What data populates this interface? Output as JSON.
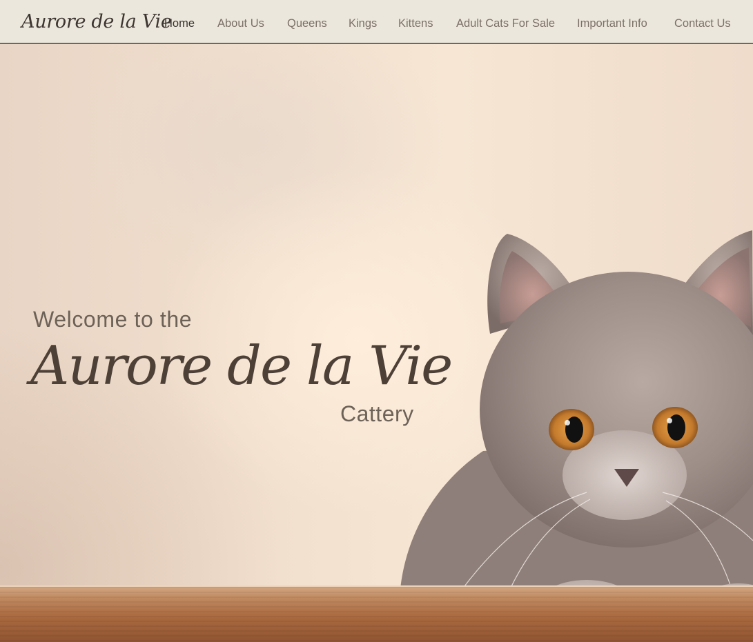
{
  "header": {
    "logo": "Aurore de la Vie",
    "nav": [
      {
        "label": "Home",
        "active": true
      },
      {
        "label": "About Us",
        "active": false
      },
      {
        "label": "Queens",
        "active": false
      },
      {
        "label": "Kings",
        "active": false
      },
      {
        "label": "Kittens",
        "active": false
      },
      {
        "label": "Adult Cats For Sale",
        "active": false
      },
      {
        "label": "Important Info",
        "active": false
      },
      {
        "label": "Contact Us",
        "active": false
      }
    ]
  },
  "hero": {
    "welcome": "Welcome to the",
    "name": "Aurore de la Vie",
    "subtitle": "Cattery"
  },
  "colors": {
    "header_bg": "#ece7dd",
    "text_dark": "#3a3330",
    "text_muted": "#7b7067",
    "hero_title": "#4d4037"
  }
}
